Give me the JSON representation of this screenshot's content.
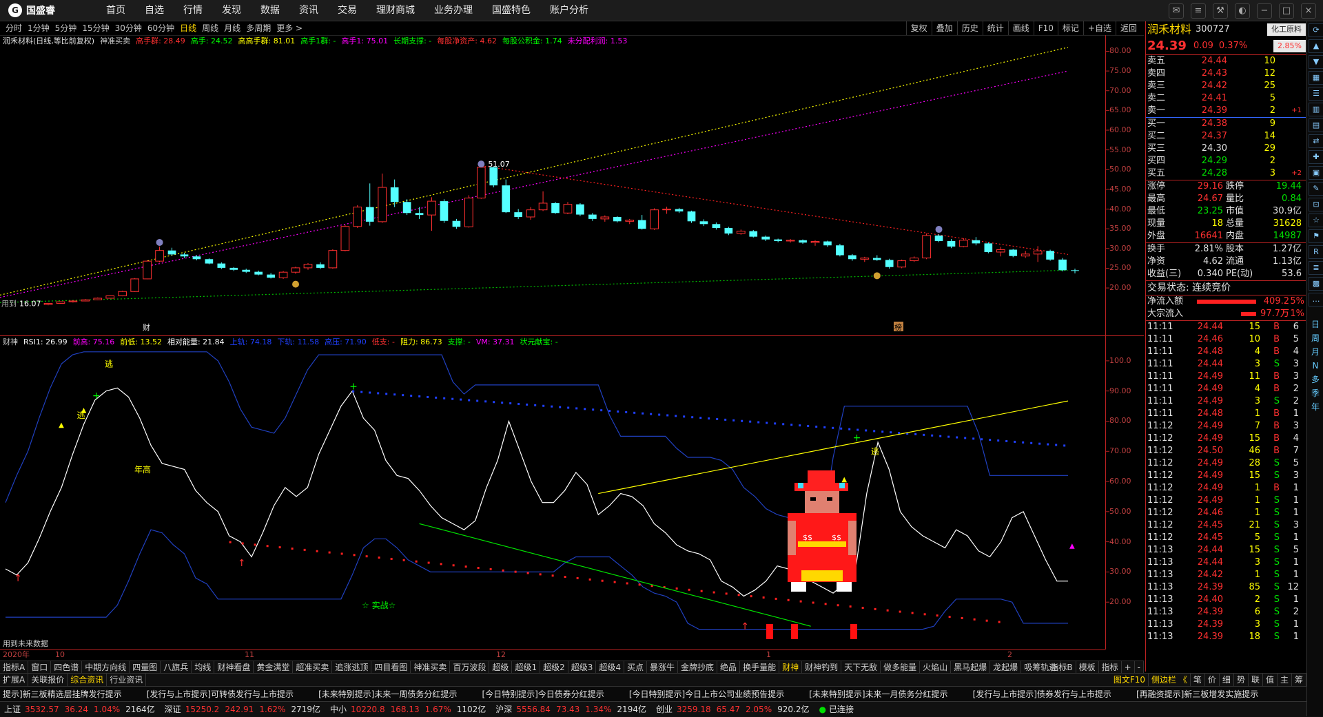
{
  "app": {
    "brand": "国盛睿",
    "nav": [
      "首页",
      "自选",
      "行情",
      "发现",
      "数据",
      "资讯",
      "交易",
      "理财商城",
      "业务办理",
      "国盛特色",
      "账户分析"
    ]
  },
  "period_bar": {
    "periods": [
      "分时",
      "1分钟",
      "5分钟",
      "15分钟",
      "30分钟",
      "60分钟",
      "日线",
      "周线",
      "月线",
      "多周期",
      "更多 >"
    ],
    "active": "日线",
    "tools": [
      "复权",
      "叠加",
      "历史",
      "统计",
      "画线",
      "F10",
      "标记",
      "+自选",
      "返回"
    ]
  },
  "main_legend": {
    "title": "润禾材料(日线,等比前复权)",
    "items": [
      {
        "text": "神准买卖",
        "color": "#c8c8c8"
      },
      {
        "text": "高手群: 28.49",
        "color": "#ff3030"
      },
      {
        "text": "高手: 24.52",
        "color": "#00ff00"
      },
      {
        "text": "高高手群: 81.01",
        "color": "#ffff00"
      },
      {
        "text": "高手1群: -",
        "color": "#00ff00"
      },
      {
        "text": "高手1: 75.01",
        "color": "#ff00ff"
      },
      {
        "text": "长期支撑: -",
        "color": "#00ff00"
      },
      {
        "text": "每股净资产: 4.62",
        "color": "#ff3030"
      },
      {
        "text": "每股公积金: 1.74",
        "color": "#00ff00"
      },
      {
        "text": "未分配利润: 1.53",
        "color": "#ff00ff"
      }
    ],
    "peak_label": "51.07",
    "low_label": "16.07",
    "low_prefix": "用到",
    "cai_marker": "财",
    "bang_marker": "榜"
  },
  "price_axis": [
    "80.00",
    "75.00",
    "70.00",
    "65.00",
    "60.00",
    "55.00",
    "50.00",
    "45.00",
    "40.00",
    "35.00",
    "30.00",
    "25.00",
    "20.00"
  ],
  "candles": [
    [
      15.8,
      16.2,
      15.6,
      16.1
    ],
    [
      16.1,
      16.6,
      16.0,
      16.5
    ],
    [
      16.5,
      16.9,
      16.3,
      16.7
    ],
    [
      16.7,
      17.2,
      16.6,
      17.0
    ],
    [
      17.0,
      17.6,
      16.9,
      17.4
    ],
    [
      17.4,
      18.1,
      17.3,
      18.0
    ],
    [
      18.0,
      19.3,
      17.9,
      19.1
    ],
    [
      19.1,
      22.5,
      19.0,
      22.3
    ],
    [
      22.3,
      27.0,
      22.2,
      26.8
    ],
    [
      26.8,
      30.5,
      26.5,
      29.5
    ],
    [
      29.5,
      30.2,
      28.2,
      28.5
    ],
    [
      28.5,
      28.9,
      27.6,
      28.0
    ],
    [
      28.0,
      28.3,
      27.0,
      27.3
    ],
    [
      27.3,
      27.5,
      26.0,
      26.2
    ],
    [
      26.2,
      26.5,
      24.8,
      25.1
    ],
    [
      25.1,
      25.3,
      24.3,
      24.6
    ],
    [
      24.6,
      24.9,
      23.8,
      24.1
    ],
    [
      24.1,
      24.4,
      23.2,
      23.4
    ],
    [
      23.4,
      23.8,
      22.4,
      22.6
    ],
    [
      22.6,
      24.3,
      22.3,
      24.0
    ],
    [
      24.0,
      25.4,
      23.6,
      25.1
    ],
    [
      25.1,
      26.3,
      24.6,
      26.0
    ],
    [
      26.0,
      26.5,
      24.8,
      25.1
    ],
    [
      25.1,
      29.8,
      24.9,
      29.5
    ],
    [
      29.5,
      36.0,
      29.3,
      35.6
    ],
    [
      35.6,
      41.0,
      35.2,
      40.5
    ],
    [
      40.5,
      46.5,
      35.8,
      36.8
    ],
    [
      36.8,
      49.0,
      36.5,
      45.5
    ],
    [
      45.5,
      47.5,
      40.5,
      41.8
    ],
    [
      41.8,
      42.5,
      38.5,
      39.0
    ],
    [
      39.0,
      40.5,
      37.5,
      38.5
    ],
    [
      38.5,
      43.0,
      34.5,
      42.0
    ],
    [
      42.0,
      42.5,
      36.5,
      37.0
    ],
    [
      37.0,
      37.5,
      35.0,
      35.5
    ],
    [
      35.5,
      43.5,
      35.3,
      42.8
    ],
    [
      42.8,
      51.07,
      42.6,
      50.6
    ],
    [
      50.6,
      50.8,
      45.5,
      46.0
    ],
    [
      46.0,
      47.5,
      39.0,
      39.2
    ],
    [
      39.2,
      40.0,
      37.5,
      38.0
    ],
    [
      38.0,
      40.5,
      37.3,
      39.8
    ],
    [
      39.8,
      44.5,
      39.5,
      41.5
    ],
    [
      41.5,
      41.8,
      38.8,
      39.0
    ],
    [
      39.0,
      41.8,
      38.7,
      41.2
    ],
    [
      41.2,
      41.5,
      38.2,
      38.6
    ],
    [
      38.6,
      39.0,
      37.0,
      37.5
    ],
    [
      37.5,
      38.4,
      36.8,
      38.0
    ],
    [
      38.0,
      38.2,
      36.6,
      36.9
    ],
    [
      36.9,
      37.5,
      36.2,
      37.2
    ],
    [
      37.2,
      38.5,
      34.8,
      35.0
    ],
    [
      35.0,
      40.2,
      34.7,
      39.8
    ],
    [
      39.8,
      40.6,
      38.8,
      40.0
    ],
    [
      40.0,
      40.3,
      39.0,
      39.4
    ],
    [
      39.4,
      39.6,
      36.5,
      36.9
    ],
    [
      36.9,
      37.4,
      35.7,
      36.2
    ],
    [
      36.2,
      36.6,
      34.8,
      35.2
    ],
    [
      35.2,
      35.5,
      33.4,
      33.8
    ],
    [
      33.8,
      34.8,
      33.5,
      34.4
    ],
    [
      34.4,
      34.7,
      32.8,
      33.0
    ],
    [
      33.0,
      33.3,
      31.9,
      32.3
    ],
    [
      32.3,
      32.5,
      31.6,
      31.9
    ],
    [
      31.9,
      32.4,
      31.5,
      32.1
    ],
    [
      32.1,
      32.3,
      31.2,
      31.5
    ],
    [
      31.5,
      32.1,
      30.7,
      31.8
    ],
    [
      31.8,
      32.0,
      30.4,
      30.8
    ],
    [
      30.8,
      31.2,
      28.0,
      28.3
    ],
    [
      28.3,
      28.6,
      26.9,
      27.3
    ],
    [
      27.3,
      27.9,
      26.6,
      27.6
    ],
    [
      27.6,
      28.3,
      26.9,
      27.1
    ],
    [
      27.1,
      27.4,
      24.9,
      25.3
    ],
    [
      25.3,
      27.2,
      25.0,
      26.9
    ],
    [
      26.9,
      28.0,
      26.6,
      27.6
    ],
    [
      27.6,
      33.8,
      27.3,
      33.3
    ],
    [
      33.3,
      33.6,
      31.6,
      31.9
    ],
    [
      31.9,
      32.4,
      30.1,
      30.5
    ],
    [
      30.5,
      32.6,
      30.3,
      32.1
    ],
    [
      32.1,
      32.9,
      30.8,
      31.3
    ],
    [
      31.3,
      31.6,
      28.8,
      29.1
    ],
    [
      29.1,
      30.4,
      28.0,
      29.7
    ],
    [
      29.7,
      29.9,
      27.8,
      28.1
    ],
    [
      28.1,
      29.4,
      27.6,
      28.6
    ],
    [
      28.6,
      30.6,
      26.6,
      29.4
    ],
    [
      29.4,
      29.7,
      26.9,
      27.2
    ],
    [
      27.2,
      27.6,
      24.2,
      24.5
    ],
    [
      24.5,
      24.9,
      23.7,
      24.39
    ]
  ],
  "rsi_legend": {
    "items": [
      {
        "text": "财神",
        "color": "#c8c8c8"
      },
      {
        "text": "RSI1: 26.99",
        "color": "#ffffff"
      },
      {
        "text": "前高: 75.16",
        "color": "#ff00ff"
      },
      {
        "text": "前低: 13.52",
        "color": "#ffff00"
      },
      {
        "text": "相对能量: 21.84",
        "color": "#ffffff"
      },
      {
        "text": "上轨: 74.18",
        "color": "#2040ff"
      },
      {
        "text": "下轨: 11.58",
        "color": "#2040ff"
      },
      {
        "text": "高压: 71.90",
        "color": "#2040ff"
      },
      {
        "text": "低支: -",
        "color": "#ff3030"
      },
      {
        "text": "阻力: 86.73",
        "color": "#ffff00"
      },
      {
        "text": "支撑: -",
        "color": "#00ff00"
      },
      {
        "text": "VM: 37.31",
        "color": "#ff00ff"
      },
      {
        "text": "状元献宝: -",
        "color": "#00ff00"
      }
    ],
    "labels": {
      "escape": "逃",
      "year_high": "年高",
      "combat": "☆ 实战☆",
      "future": "用到未来数据"
    }
  },
  "rsi_axis": [
    "100.0",
    "90.00",
    "80.00",
    "70.00",
    "60.00",
    "50.00",
    "40.00",
    "30.00",
    "20.00"
  ],
  "rsi_values": [
    31,
    29,
    33,
    41,
    50,
    58,
    69,
    79,
    87,
    90,
    91,
    88,
    81,
    72,
    66,
    65,
    64,
    57,
    53,
    50,
    42,
    40,
    35,
    43,
    52,
    58,
    55,
    58,
    69,
    77,
    85,
    90,
    81,
    77,
    67,
    62,
    61,
    57,
    52,
    48,
    46,
    44,
    47,
    58,
    67,
    80,
    70,
    60,
    53,
    53,
    57,
    63,
    59,
    49,
    52,
    56,
    55,
    52,
    46,
    43,
    39,
    37,
    36,
    34,
    27,
    25,
    22,
    24,
    27,
    32,
    31,
    29,
    27,
    25,
    23,
    26,
    31,
    56,
    73,
    64,
    50,
    45,
    42,
    40,
    38,
    44,
    42,
    37,
    35,
    40,
    48,
    50,
    42,
    34,
    27,
    27
  ],
  "dates": [
    "2020年",
    "10",
    "11",
    "12",
    "1",
    "2"
  ],
  "tabs_row1": [
    "指标A",
    "窗口",
    "四色谱",
    "中期方向线",
    "四量图",
    "八旗兵",
    "均线",
    "财神看盘",
    "黄金满堂",
    "超准买卖",
    "追涨逃顶",
    "四目看图",
    "神准买卖",
    "百万波段",
    "超级",
    "超级1",
    "超级2",
    "超级3",
    "超级4",
    "买点",
    "暴涨牛",
    "金牌抄底",
    "绝品",
    "换手量能",
    "财神",
    "财神钓到",
    "天下无敌",
    "做多能量",
    "火焰山",
    "黑马起爆",
    "龙起爆",
    "吸筹轨迹"
  ],
  "tabs_row1_active": "财神",
  "tabs_row1_right": [
    "指标B",
    "模板",
    "指标",
    "+",
    "-"
  ],
  "tabs_row2": [
    "扩展A",
    "关联报价",
    "综合资讯",
    "行业资讯"
  ],
  "tabs_row2_right": [
    "图文F10",
    "侧边栏 《",
    "笔",
    "价",
    "细",
    "势",
    "联",
    "值",
    "主",
    "筹"
  ],
  "ticker": [
    "提示]新三板精选层挂牌发行提示",
    "[发行与上市提示]可转债发行与上市提示",
    "[未来特别提示]未来一周债务分红提示",
    "[今日特别提示]今日债券分红提示",
    "[今日特别提示]今日上市公司业绩预告提示",
    "[未来特别提示]未来一月债务分红提示",
    "[发行与上市提示]债券发行与上市提示",
    "[再融资提示]新三板增发实施提示"
  ],
  "status": [
    {
      "name": "上证",
      "v": "3532.57",
      "c": "36.24",
      "p": "1.04%",
      "a": "2164亿"
    },
    {
      "name": "深证",
      "v": "15250.2",
      "c": "242.91",
      "p": "1.62%",
      "a": "2719亿"
    },
    {
      "name": "中小",
      "v": "10220.8",
      "c": "168.13",
      "p": "1.67%",
      "a": "1102亿"
    },
    {
      "name": "沪深",
      "v": "5556.84",
      "c": "73.43",
      "p": "1.34%",
      "a": "2194亿"
    },
    {
      "name": "创业",
      "v": "3259.18",
      "c": "65.47",
      "p": "2.05%",
      "a": "920.2亿"
    }
  ],
  "status_conn": "已连接",
  "quote": {
    "name": "润禾材料",
    "code": "300727",
    "sector": "化工原料",
    "sector_pct": "2.85%",
    "price": "24.39",
    "change": "0.09",
    "pct": "0.37%",
    "asks": [
      {
        "label": "卖五",
        "price": "24.44",
        "vol": "10",
        "flag": ""
      },
      {
        "label": "卖四",
        "price": "24.43",
        "vol": "12",
        "flag": ""
      },
      {
        "label": "卖三",
        "price": "24.42",
        "vol": "25",
        "flag": ""
      },
      {
        "label": "卖二",
        "price": "24.41",
        "vol": "5",
        "flag": ""
      },
      {
        "label": "卖一",
        "price": "24.39",
        "vol": "2",
        "flag": "+1"
      }
    ],
    "bids": [
      {
        "label": "买一",
        "price": "24.38",
        "vol": "9",
        "flag": ""
      },
      {
        "label": "买二",
        "price": "24.37",
        "vol": "14",
        "flag": ""
      },
      {
        "label": "买三",
        "price": "24.30",
        "vol": "29",
        "flag": ""
      },
      {
        "label": "买四",
        "price": "24.29",
        "vol": "2",
        "flag": ""
      },
      {
        "label": "买五",
        "price": "24.28",
        "vol": "3",
        "flag": "+2"
      }
    ],
    "stats": [
      {
        "l1": "涨停",
        "v1": "29.16",
        "c1": "#ff3030",
        "l2": "跌停",
        "v2": "19.44",
        "c2": "#00e000"
      },
      {
        "l1": "最高",
        "v1": "24.67",
        "c1": "#ff3030",
        "l2": "量比",
        "v2": "0.84",
        "c2": "#00e000"
      },
      {
        "l1": "最低",
        "v1": "23.25",
        "c1": "#00e000",
        "l2": "市值",
        "v2": "30.9亿",
        "c2": "#e0e0e0"
      },
      {
        "l1": "现量",
        "v1": "18",
        "c1": "#ffff00",
        "l2": "总量",
        "v2": "31628",
        "c2": "#ffff00"
      },
      {
        "l1": "外盘",
        "v1": "16641",
        "c1": "#ff3030",
        "l2": "内盘",
        "v2": "14987",
        "c2": "#00e000"
      }
    ],
    "stats2": [
      {
        "l1": "换手",
        "v1": "2.81%",
        "l2": "股本",
        "v2": "1.27亿"
      },
      {
        "l1": "净资",
        "v1": "4.62",
        "l2": "流通",
        "v2": "1.13亿"
      },
      {
        "l1": "收益(三)",
        "v1": "0.340",
        "l2": "PE(动)",
        "v2": "53.6"
      }
    ],
    "trade_state": "交易状态: 连续竞价",
    "net_inflow_label": "净流入额",
    "net_inflow": "409.2万",
    "net_inflow_pct": "5%",
    "big_inflow_label": "大宗流入",
    "big_inflow": "97.7万",
    "big_inflow_pct": "1%"
  },
  "ticks": [
    [
      "11:11",
      "24.44",
      "15",
      "B",
      "6"
    ],
    [
      "11:11",
      "24.46",
      "10",
      "B",
      "5"
    ],
    [
      "11:11",
      "24.48",
      "4",
      "B",
      "4"
    ],
    [
      "11:11",
      "24.44",
      "3",
      "S",
      "3"
    ],
    [
      "11:11",
      "24.49",
      "11",
      "B",
      "3"
    ],
    [
      "11:11",
      "24.49",
      "4",
      "B",
      "2"
    ],
    [
      "11:11",
      "24.49",
      "3",
      "S",
      "2"
    ],
    [
      "11:11",
      "24.48",
      "1",
      "B",
      "1"
    ],
    [
      "11:12",
      "24.49",
      "7",
      "B",
      "3"
    ],
    [
      "11:12",
      "24.49",
      "15",
      "B",
      "4"
    ],
    [
      "11:12",
      "24.50",
      "46",
      "B",
      "7"
    ],
    [
      "11:12",
      "24.49",
      "28",
      "S",
      "5"
    ],
    [
      "11:12",
      "24.49",
      "15",
      "S",
      "3"
    ],
    [
      "11:12",
      "24.49",
      "1",
      "B",
      "1"
    ],
    [
      "11:12",
      "24.49",
      "1",
      "S",
      "1"
    ],
    [
      "11:12",
      "24.46",
      "1",
      "S",
      "1"
    ],
    [
      "11:12",
      "24.45",
      "21",
      "S",
      "3"
    ],
    [
      "11:12",
      "24.45",
      "5",
      "S",
      "1"
    ],
    [
      "11:13",
      "24.44",
      "15",
      "S",
      "5"
    ],
    [
      "11:13",
      "24.44",
      "3",
      "S",
      "1"
    ],
    [
      "11:13",
      "24.42",
      "1",
      "S",
      "1"
    ],
    [
      "11:13",
      "24.39",
      "85",
      "S",
      "12"
    ],
    [
      "11:13",
      "24.40",
      "2",
      "S",
      "1"
    ],
    [
      "11:13",
      "24.39",
      "6",
      "S",
      "2"
    ],
    [
      "11:13",
      "24.39",
      "3",
      "S",
      "1"
    ],
    [
      "11:13",
      "24.39",
      "18",
      "S",
      "1"
    ]
  ],
  "side_strip": [
    "日",
    "周",
    "月",
    "N",
    "多",
    "季",
    "年"
  ]
}
